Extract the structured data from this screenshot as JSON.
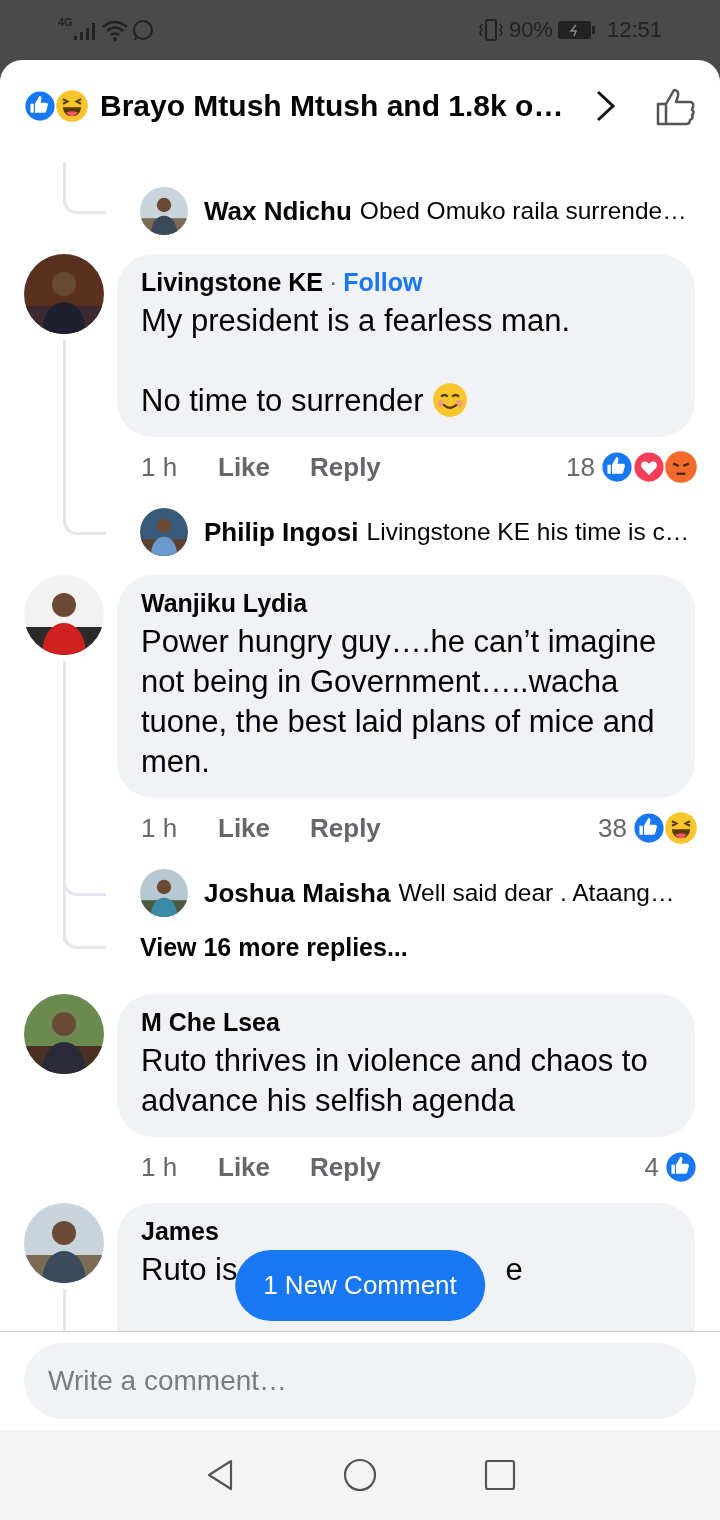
{
  "status_bar": {
    "network": "4G",
    "battery": "90%",
    "time": "12:51"
  },
  "header": {
    "reactions": [
      {
        "kind": "like"
      },
      {
        "kind": "haha"
      }
    ],
    "title": "Brayo Mtush Mtush and 1.8k o…"
  },
  "threads": [
    {
      "kind": "reply",
      "name": "Wax Ndichu",
      "text": "Obed Omuko raila surrende…",
      "last": true
    },
    {
      "kind": "comment",
      "name": "Livingstone KE",
      "separator": "·",
      "follow": "Follow",
      "paragraphs": [
        {
          "text": "My president is a fearless man."
        },
        {
          "text": "No time to surrender",
          "emoji": true
        }
      ],
      "time": "1 h",
      "like": "Like",
      "reply": "Reply",
      "count": "18",
      "reactions": [
        {
          "kind": "like"
        },
        {
          "kind": "love"
        },
        {
          "kind": "angry"
        }
      ],
      "thread": true
    },
    {
      "kind": "reply",
      "name": "Philip Ingosi",
      "text": "Livingstone KE his time is c…",
      "last": true
    },
    {
      "kind": "comment",
      "name": "Wanjiku Lydia",
      "paragraphs": [
        {
          "text": "Power hungry guy….he can’t imagine not being in Government…..wacha tuone, the best laid plans of mice and men."
        }
      ],
      "time": "1 h",
      "like": "Like",
      "reply": "Reply",
      "count": "38",
      "reactions": [
        {
          "kind": "like"
        },
        {
          "kind": "haha"
        }
      ],
      "thread": true
    },
    {
      "kind": "reply",
      "name": "Joshua Maisha",
      "text": "Well said dear . Ataang…",
      "last": false
    },
    {
      "kind": "more",
      "text": "View 16 more replies..."
    },
    {
      "kind": "comment",
      "name": "M Che Lsea",
      "paragraphs": [
        {
          "text": "Ruto thrives in violence and chaos to advance his selfish agenda"
        }
      ],
      "time": "1 h",
      "like": "Like",
      "reply": "Reply",
      "count": "4",
      "reactions": [
        {
          "kind": "like"
        }
      ],
      "thread": false
    },
    {
      "kind": "partial",
      "name": "James",
      "text": "Ruto is",
      "tail": "e"
    }
  ],
  "new_comment": "1 New Comment",
  "composer": {
    "placeholder": "Write a comment…"
  }
}
